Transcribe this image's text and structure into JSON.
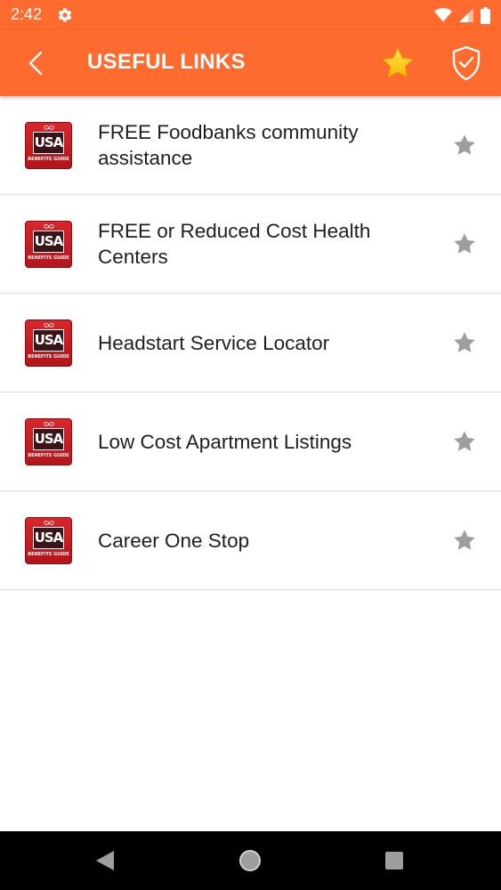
{
  "status_bar": {
    "time": "2:42"
  },
  "app_bar": {
    "title": "USEFUL LINKS"
  },
  "list": {
    "items": [
      {
        "label": "FREE Foodbanks community assistance"
      },
      {
        "label": "FREE or Reduced Cost Health Centers"
      },
      {
        "label": "Headstart Service Locator"
      },
      {
        "label": "Low Cost Apartment Listings"
      },
      {
        "label": "Career One Stop"
      }
    ]
  },
  "logo": {
    "text": "USA",
    "subtext": "BENEFITS GUIDE"
  },
  "colors": {
    "accent": "#ff6a2f",
    "logo_red": "#d9262c",
    "star_gray": "#9e9e9e",
    "star_gold": "#ffcc1a"
  },
  "icons": {
    "back": "chevron-left-icon",
    "favorites": "star-icon",
    "shield": "shield-check-icon",
    "item_star": "star-icon"
  }
}
